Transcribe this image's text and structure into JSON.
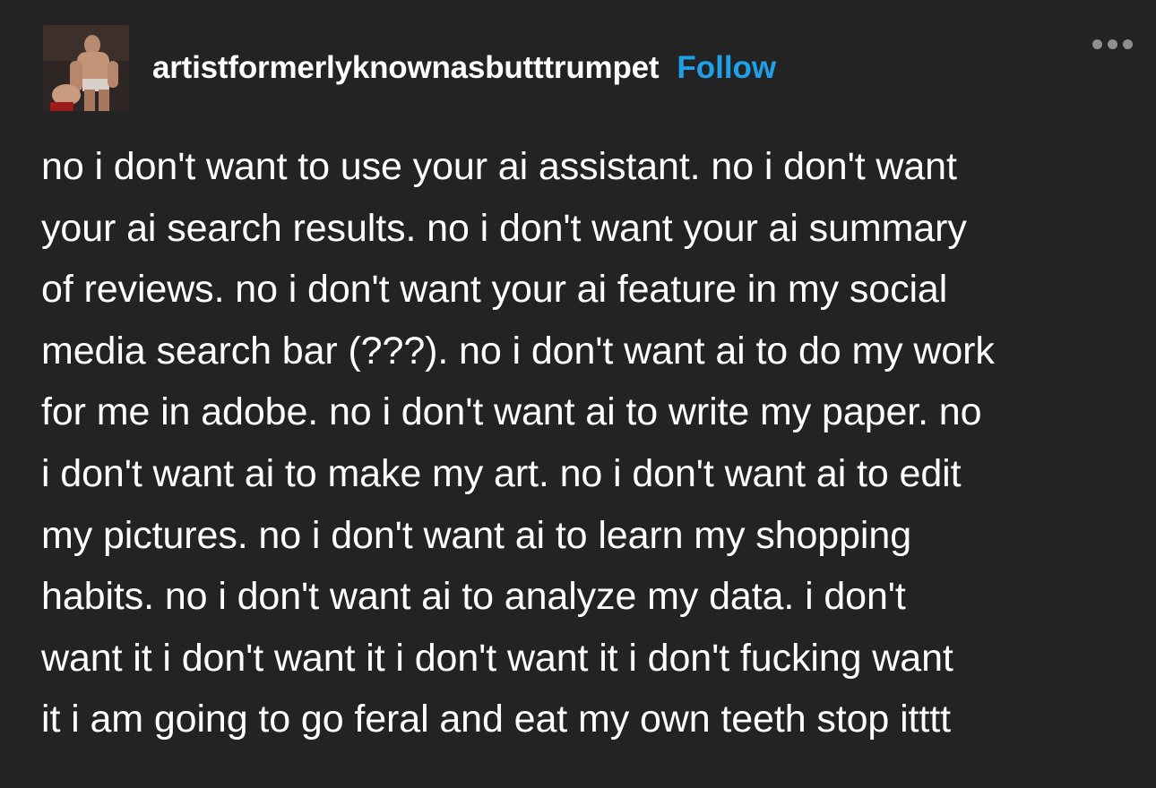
{
  "post": {
    "username": "artistformerlyknownasbutttrumpet",
    "follow_label": "Follow",
    "avatar_icon": "user-avatar-photo",
    "more_icon": "ellipsis-icon",
    "colors": {
      "background": "#232323",
      "text": "#ffffff",
      "follow": "#1fa0e8",
      "more": "#8e8e8e"
    },
    "lines": [
      "no i don't want to use your ai assistant. no i don't want",
      "your ai search results. no i don't want your ai summary",
      "of reviews. no i don't want your ai feature in my social",
      "media search bar (???). no i don't want ai to do my work",
      "for me in adobe. no i don't want ai to write my paper. no",
      "i don't want ai to make my art. no i don't want ai to edit",
      "my pictures. no i don't want ai to learn my shopping",
      "habits. no i don't want ai to analyze my data. i don't",
      "want it i don't want it i don't want it i don't fucking want",
      "it i am going to go feral and eat my own teeth stop itttt"
    ]
  }
}
